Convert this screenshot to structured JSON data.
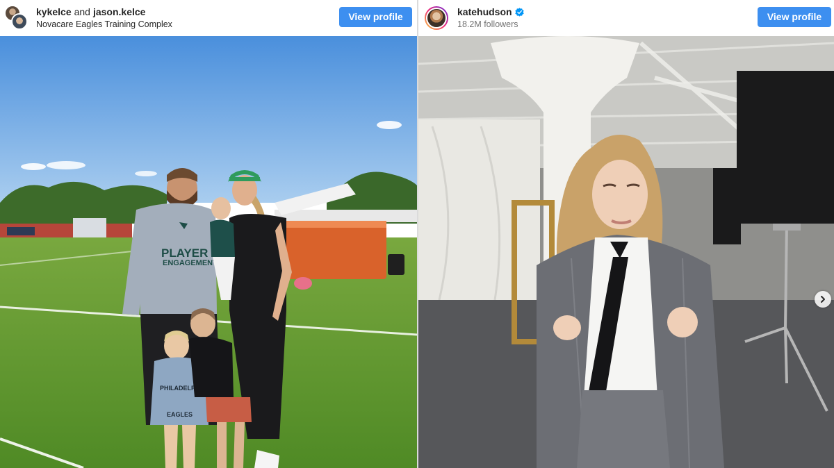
{
  "posts": [
    {
      "users": [
        "kykelce",
        "jason.kelce"
      ],
      "conjunction": "and",
      "location": "Novacare Eagles Training Complex",
      "view_profile_label": "View profile",
      "photo_shirt_text": [
        "PLAYER",
        "ENGAGEMENT"
      ],
      "photo_kid_shirt_text": [
        "PHILADELPHIA",
        "EAGLES"
      ]
    },
    {
      "username": "katehudson",
      "verified": true,
      "followers": "18.2M followers",
      "view_profile_label": "View profile"
    }
  ],
  "icons": {
    "verified": "verified-badge-icon",
    "carousel_next": "chevron-right-icon"
  },
  "colors": {
    "button_blue": "#3d8ff0",
    "verified_blue": "#0095f6",
    "sky": "#5b9fe3",
    "field_green": "#5e9a2e"
  }
}
